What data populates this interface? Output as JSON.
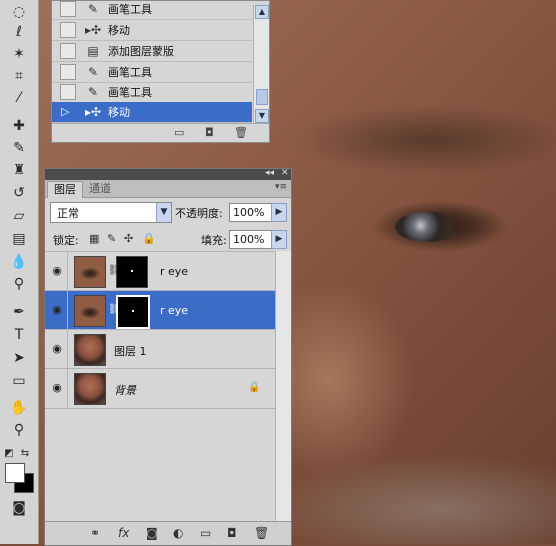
{
  "history": {
    "items": [
      {
        "label": "画笔工具",
        "icon": "brush-icon",
        "selected": false
      },
      {
        "label": "移动",
        "icon": "move-icon",
        "selected": false
      },
      {
        "label": "添加图层蒙版",
        "icon": "layer-mask-icon",
        "selected": false
      },
      {
        "label": "画笔工具",
        "icon": "brush-icon",
        "selected": false
      },
      {
        "label": "画笔工具",
        "icon": "brush-icon",
        "selected": false
      },
      {
        "label": "移动",
        "icon": "move-icon",
        "selected": true
      }
    ]
  },
  "layers_panel": {
    "tabs": [
      {
        "label": "图层",
        "active": true
      },
      {
        "label": "通道",
        "active": false
      }
    ],
    "blend_mode": "正常",
    "opacity_label": "不透明度:",
    "opacity_value": "100%",
    "lock_label": "锁定:",
    "fill_label": "填充:",
    "fill_value": "100%",
    "layers": [
      {
        "name": "r eye",
        "thumbnail": "eye",
        "has_mask": true,
        "selected": false,
        "italic": false,
        "locked": false
      },
      {
        "name": "r eye",
        "thumbnail": "eye",
        "has_mask": true,
        "selected": true,
        "italic": false,
        "locked": false
      },
      {
        "name": "图层 1",
        "thumbnail": "face",
        "has_mask": false,
        "selected": false,
        "italic": false,
        "locked": false
      },
      {
        "name": "背景",
        "thumbnail": "face",
        "has_mask": false,
        "selected": false,
        "italic": true,
        "locked": true
      }
    ]
  },
  "colors": {
    "selection": "#3b6cc8",
    "panel": "#d6d6d6",
    "foreground": "#ffffff",
    "background": "#000000"
  }
}
